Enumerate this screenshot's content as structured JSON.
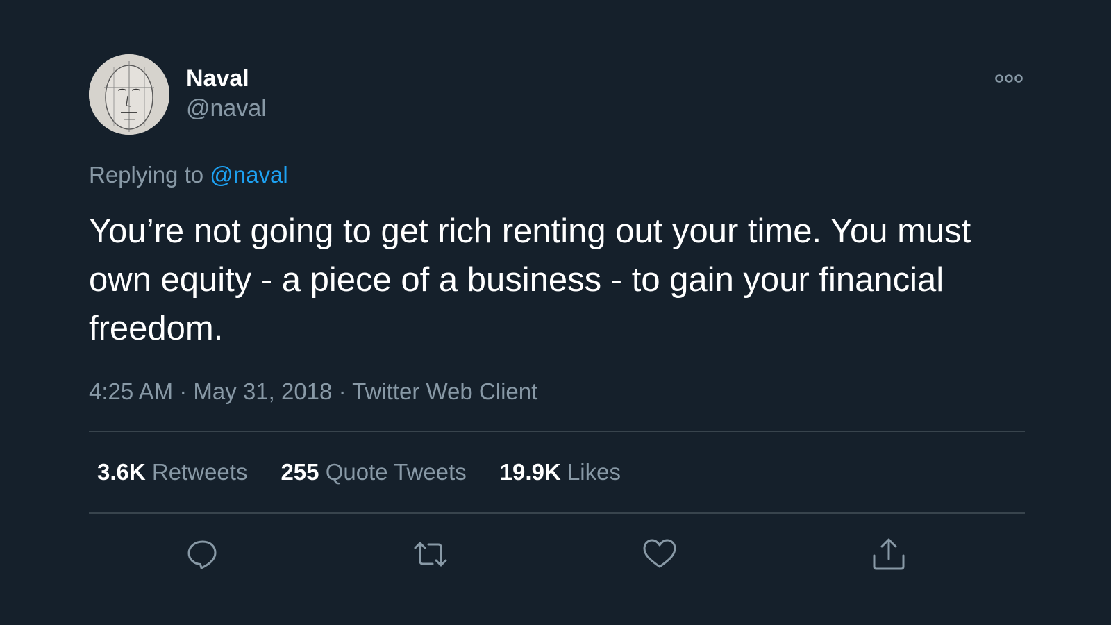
{
  "author": {
    "display_name": "Naval",
    "handle": "@naval",
    "avatar_icon": "sketch-face-avatar"
  },
  "menu": {
    "icon": "more-options-icon"
  },
  "reply": {
    "prefix": "Replying to",
    "mention": "@naval"
  },
  "tweet": {
    "text": "You’re not going to get rich renting out your time. You must own equity - a piece of a business - to gain your financial freedom.",
    "time": "4:25 AM",
    "separator": "·",
    "date": "May 31, 2018",
    "source": "Twitter Web Client"
  },
  "stats": [
    {
      "count": "3.6K",
      "label": "Retweets"
    },
    {
      "count": "255",
      "label": "Quote Tweets"
    },
    {
      "count": "19.9K",
      "label": "Likes"
    }
  ],
  "actions": {
    "reply_icon": "reply-icon",
    "retweet_icon": "retweet-icon",
    "like_icon": "heart-icon",
    "share_icon": "share-icon"
  },
  "colors": {
    "background": "#15202b",
    "text_primary": "#ffffff",
    "text_secondary": "#8899a6",
    "accent": "#1da1f2",
    "divider": "#38444d"
  }
}
